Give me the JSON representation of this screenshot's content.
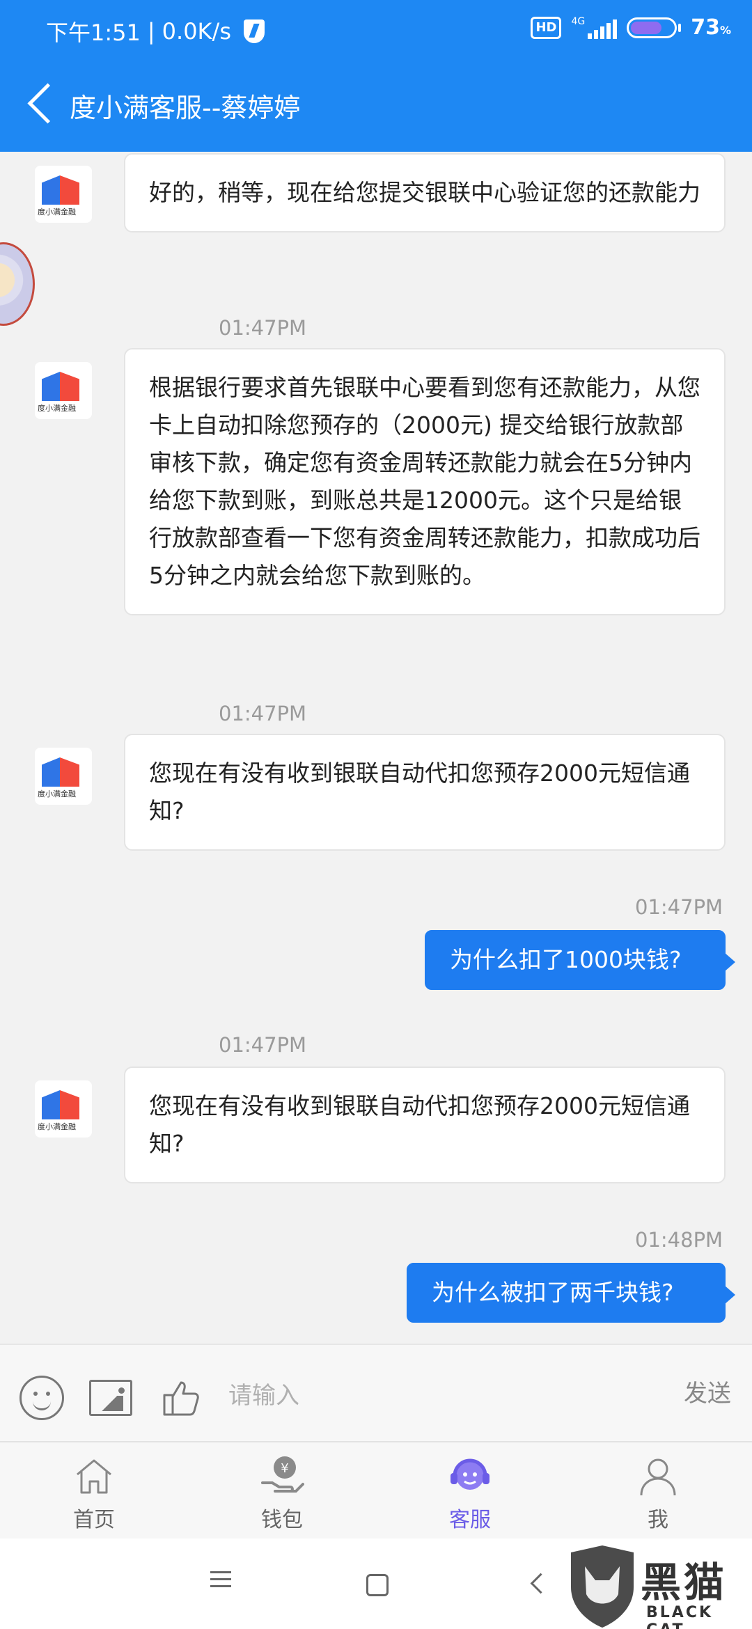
{
  "status_bar": {
    "time": "下午1:51",
    "speed": "0.0K/s",
    "hd": "HD",
    "network": "4G",
    "battery_pct": "73",
    "battery_unit": "%",
    "battery_level": 0.73
  },
  "header": {
    "title": "度小满客服--蔡婷婷"
  },
  "avatar_caption": "度小满金融",
  "messages": [
    {
      "side": "left",
      "text": "好的，稍等，现在给您提交银联中心验证您的还款能力"
    },
    {
      "timestamp": "01:47PM"
    },
    {
      "side": "left",
      "text": "根据银行要求首先银联中心要看到您有还款能力，从您卡上自动扣除您预存的（2000元) 提交给银行放款部审核下款，确定您有资金周转还款能力就会在5分钟内给您下款到账，到账总共是12000元。这个只是给银行放款部查看一下您有资金周转还款能力，扣款成功后5分钟之内就会给您下款到账的。"
    },
    {
      "timestamp": "01:47PM"
    },
    {
      "side": "left",
      "text": "您现在有没有收到银联自动代扣您预存2000元短信通知?"
    },
    {
      "timestamp": "01:47PM"
    },
    {
      "side": "right",
      "text": "为什么扣了1000块钱?"
    },
    {
      "timestamp": "01:47PM"
    },
    {
      "side": "left",
      "text": "您现在有没有收到银联自动代扣您预存2000元短信通知?"
    },
    {
      "timestamp": "01:48PM"
    },
    {
      "side": "right",
      "text": "为什么被扣了两千块钱?"
    }
  ],
  "input_bar": {
    "placeholder": "请输入",
    "value": "",
    "send_label": "发送"
  },
  "bottom_nav": {
    "items": [
      {
        "label": "首页",
        "icon": "home-icon"
      },
      {
        "label": "钱包",
        "icon": "wallet-icon"
      },
      {
        "label": "客服",
        "icon": "customer-service-icon",
        "active": true
      },
      {
        "label": "我",
        "icon": "profile-icon"
      }
    ]
  },
  "watermark": {
    "title": "黑猫",
    "subtitle": "BLACK CAT"
  },
  "colors": {
    "brand_blue": "#1e88f3",
    "bubble_blue": "#1e7cf0",
    "nav_active": "#6b5ce7"
  }
}
